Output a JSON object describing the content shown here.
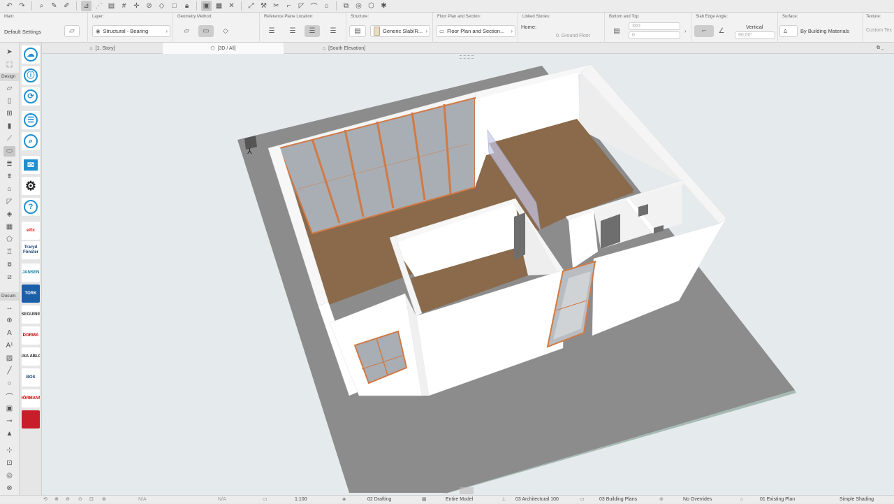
{
  "infobox": {
    "main_label": "Main:",
    "main_value": "Default Settings",
    "layer_label": "Layer:",
    "layer_value": "Structural - Bearing",
    "geometry_label": "Geometry Method:",
    "refplane_label": "Reference Plane Location:",
    "structure_label": "Structure:",
    "structure_value": "Generic Slab/R...",
    "floorplan_label": "Floor Plan and Section:",
    "floorplan_value": "Floor Plan and Section...",
    "linked_label": "Linked Stories:",
    "linked_home": "Home:",
    "linked_story": "0. Ground Floor",
    "bottomtop_label": "Bottom and Top:",
    "bottom_value": "300",
    "top_value": "0",
    "slabedge_label": "Slab Edge Angle:",
    "slabedge_mode": "Vertical",
    "slabedge_angle": "90,00°",
    "surface_label": "Surface:",
    "surface_value": "By Building Materials",
    "texture_label": "Texture:",
    "texture_value": "Custom Tex"
  },
  "tabs": [
    {
      "label": "[1. Story]",
      "icon": "floor-plan-icon"
    },
    {
      "label": "[3D / All]",
      "icon": "3d-window-icon"
    },
    {
      "label": "[South Elevation]",
      "icon": "elevation-icon"
    }
  ],
  "toolbox": {
    "design_header": "Design",
    "document_header": "Docum"
  },
  "vendors": [
    {
      "name": "cloud-upload-icon"
    },
    {
      "name": "info-icon"
    },
    {
      "name": "sync-icon"
    },
    {
      "name": "cloud-list-icon"
    },
    {
      "name": "cloud-search-icon"
    },
    {
      "name": "mail-icon"
    },
    {
      "name": "gear-icon"
    },
    {
      "name": "help-icon"
    },
    {
      "text": "elfix",
      "color": "#d22"
    },
    {
      "text": "Traryd\nFönster",
      "color": "#1a3d7c"
    },
    {
      "text": "JANSEN",
      "color": "#0a7fa3"
    },
    {
      "text": "TORK",
      "color": "#fff",
      "bg": "#1b5fa8"
    },
    {
      "text": "SEGUINE",
      "color": "#333"
    },
    {
      "text": "DORMA",
      "color": "#b00"
    },
    {
      "text": "ASSA ABLOY",
      "color": "#222"
    },
    {
      "text": "BOS",
      "color": "#1b3f80"
    },
    {
      "text": "HÖRMANN",
      "color": "#c00"
    },
    {
      "text": "",
      "color": "#fff",
      "bg": "#c81e2a"
    }
  ],
  "statusbar": {
    "na1": "N/A",
    "na2": "N/A",
    "scale": "1:100",
    "drafting": "02 Drafting",
    "model": "Entire Model",
    "arch": "03 Architectural 100",
    "plans": "03 Building Plans",
    "overrides": "No Overrides",
    "existing": "01 Existing Plan",
    "shading": "Simple Shading"
  },
  "colors": {
    "floor": "#8a6a4a",
    "wall_top": "#f7f7f7",
    "wall_side": "#ffffff",
    "slab": "#8c8c8c",
    "glass": "#a9aeb4",
    "frame": "#d07a45"
  }
}
